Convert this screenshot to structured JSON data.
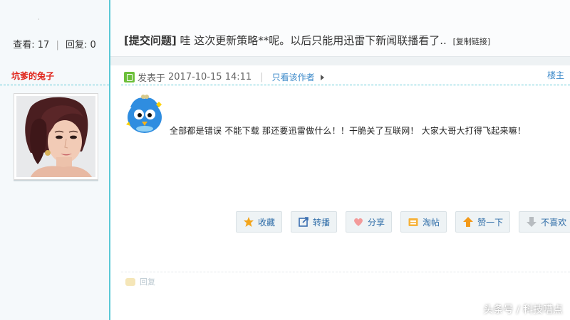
{
  "left": {
    "stats": {
      "views_label": "查看:",
      "views_count": "17",
      "separator": "|",
      "replies_label": "回复:",
      "replies_count": "0"
    },
    "author": "坑爹的兔子",
    "top_mark": "·"
  },
  "thread": {
    "category": "[提交问题]",
    "title": "哇 这次更新策略**呢。以后只能用迅雷下新闻联播看了..",
    "copy_link": "[复制链接]"
  },
  "post": {
    "posted_prefix": "发表于",
    "posted_time": "2017-10-15 14:11",
    "separator": "|",
    "only_author": "只看该作者",
    "floor": "楼主",
    "content": "全部都是错误 不能下载 那还要迅雷做什么！！干脆关了互联网！ 大家大哥大打得飞起来嘛！"
  },
  "actions": [
    {
      "label": "收藏",
      "icon": "star-icon"
    },
    {
      "label": "转播",
      "icon": "share-out-icon"
    },
    {
      "label": "分享",
      "icon": "heart-icon"
    },
    {
      "label": "淘帖",
      "icon": "tray-icon"
    },
    {
      "label": "赞一下",
      "icon": "arrow-up-icon"
    },
    {
      "label": "不喜欢",
      "icon": "arrow-down-icon"
    }
  ],
  "reply_label": "回复",
  "watermark": "头条号 / 科技嘈点",
  "colors": {
    "accent_line": "#5cc9d6",
    "author_red": "#e0251b",
    "link_blue": "#3b89c9",
    "button_bg": "#eef3f5"
  }
}
